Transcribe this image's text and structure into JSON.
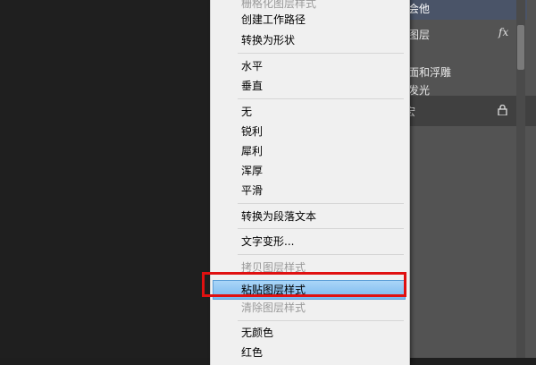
{
  "layers_panel": {
    "selected_layer": "会他",
    "layer_name": "图层",
    "fx_label": "fx",
    "effect_1": "面和浮雕",
    "effect_2": "发光",
    "background_label": "宏"
  },
  "context_menu": {
    "items": [
      {
        "label": "栅格化图层样式",
        "disabled": true
      },
      {
        "label": "创建工作路径",
        "disabled": false
      },
      {
        "label": "转换为形状",
        "disabled": false
      },
      {
        "label": "水平",
        "disabled": false
      },
      {
        "label": "垂直",
        "disabled": false
      },
      {
        "label": "无",
        "disabled": false
      },
      {
        "label": "锐利",
        "disabled": false
      },
      {
        "label": "犀利",
        "disabled": false
      },
      {
        "label": "浑厚",
        "disabled": false
      },
      {
        "label": "平滑",
        "disabled": false
      },
      {
        "label": "转换为段落文本",
        "disabled": false
      },
      {
        "label": "文字变形...",
        "disabled": false
      },
      {
        "label": "拷贝图层样式",
        "disabled": true
      },
      {
        "label": "粘贴图层样式",
        "disabled": false,
        "highlighted": true
      },
      {
        "label": "清除图层样式",
        "disabled": true
      },
      {
        "label": "无颜色",
        "disabled": false
      },
      {
        "label": "红色",
        "disabled": false
      }
    ]
  },
  "colors": {
    "highlight": "#79b8ee",
    "annotation_box": "#e01010",
    "panel_bg": "#535353"
  }
}
